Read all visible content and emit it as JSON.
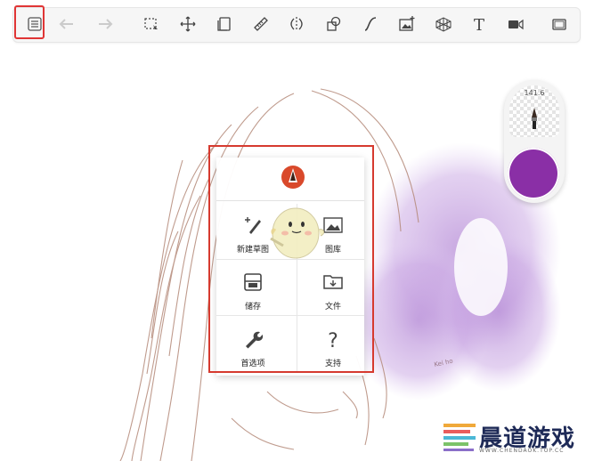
{
  "toolbar": {
    "tools": [
      {
        "icon": "menu-list-icon"
      },
      {
        "icon": "undo-icon"
      },
      {
        "icon": "redo-icon"
      },
      {
        "icon": "selection-icon"
      },
      {
        "icon": "transform-icon"
      },
      {
        "icon": "layers-icon"
      },
      {
        "icon": "ruler-icon"
      },
      {
        "icon": "symmetry-icon"
      },
      {
        "icon": "shapes-icon"
      },
      {
        "icon": "curve-icon"
      },
      {
        "icon": "image-icon"
      },
      {
        "icon": "perspective-icon"
      },
      {
        "icon": "text-icon",
        "glyph": "T"
      },
      {
        "icon": "video-icon"
      },
      {
        "icon": "fullscreen-icon"
      }
    ]
  },
  "brush_puck": {
    "size_label": "141.6",
    "color": "#8a2fa6"
  },
  "main_menu": {
    "items": [
      {
        "label": "新建草图",
        "icon": "new-sketch-icon"
      },
      {
        "label": "图库",
        "icon": "gallery-icon"
      },
      {
        "label": "储存",
        "icon": "save-icon"
      },
      {
        "label": "文件",
        "icon": "file-icon"
      },
      {
        "label": "首选项",
        "icon": "preferences-icon"
      },
      {
        "label": "支持",
        "icon": "support-icon"
      }
    ]
  },
  "watermark": {
    "title": "晨道游戏",
    "url": "WWW.CHENDAOK.TOP.CC"
  }
}
